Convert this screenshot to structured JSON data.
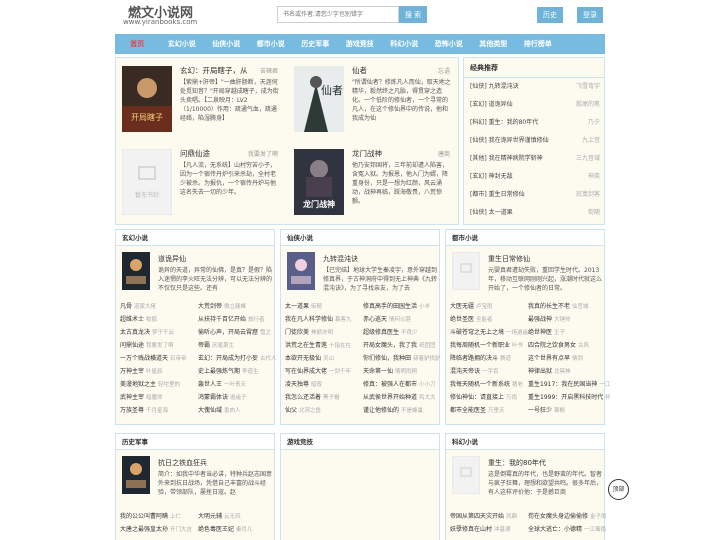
{
  "header": {
    "site_title": "燃文小说网",
    "site_url": "www.yiranbooks.com",
    "search_placeholder": "书名或作者,请您少字也别错字",
    "search_button": "搜 索",
    "history_button": "历史",
    "login_button": "登录"
  },
  "nav": [
    "首页",
    "玄幻小说",
    "仙侠小说",
    "都市小说",
    "历史军事",
    "游戏竞技",
    "科幻小说",
    "恐怖小说",
    "其他类型",
    "排行榜单"
  ],
  "featured": [
    {
      "title": "玄幻：开局瞎子，从",
      "author": "苦辣君",
      "desc": "【紫鼎+肝帝】\"一曲肝肠断，天涯何处觅知音？\"开局穿越成瞎子，成为街头卖唱。【二泉映月：LV2（1/10000）作用：疏通气血，疏通经络，陷湿腾身】"
    },
    {
      "title": "仙者",
      "author": "忘语",
      "desc": "\"所谓仙者？修炼凡人而仙，取天地之精华，毅然终之凡胎，得贯穿之造化。一个低阶的修仙者，一个寻常的凡人，在这个修仙界中的传说，他和我成为仙"
    },
    {
      "title": "问鼎仙途",
      "author": "我要发了啊",
      "desc": "【凡人流，无系统】山村穷苦小子，因为一个宿传丹炉引来杀劫，全村老少被杀。为报仇，一个宿传丹炉与他这名失去一切的少年。"
    },
    {
      "title": "龙门战神",
      "author": "唐商",
      "desc": "他乃安邦国将，三年前却遭人陷害，含冤入狱。为报恩，他入门为婿，降重身份，只是一想为红颜，风云涌动，战神再临，踩海敬畏，八荒惊颤。"
    }
  ],
  "featured_cover_text": [
    "开局瞎子",
    "仙者",
    "暂无书封",
    "龙门战神"
  ],
  "recs": {
    "title": "经典推荐",
    "items": [
      {
        "name": "[仙侠] 九转混沌诀",
        "author": "飞雪弯宇"
      },
      {
        "name": "[玄幻] 道诡异仙",
        "author": "狐尾的笔"
      },
      {
        "name": "[科幻] 重生：我的80年代",
        "author": "乃夕"
      },
      {
        "name": "[仙侠] 我在诡异世界谨慎修仙",
        "author": "九上宫"
      },
      {
        "name": "[其他] 我在精神病院学斩神",
        "author": "三九音域"
      },
      {
        "name": "[玄幻] 神封无敌",
        "author": "神奕"
      },
      {
        "name": "[都市] 重生日常修仙",
        "author": "寂寞剑客"
      },
      {
        "name": "[仙侠] 太一道果",
        "author": "街随"
      }
    ]
  },
  "categories": [
    {
      "name": "玄幻小说",
      "book_title": "道诡异仙",
      "book_desc": "诡异的天道，异常的仙佛，是真？是假？陷入迷惘的李火旺无法分辨，可以无法分辨的不仅仅只是这些。还有",
      "rows": [
        [
          "凡骨",
          "道家大佬",
          "大荒剑帝",
          "傲立巅峰"
        ],
        [
          "超维术士",
          "牧狐",
          "从扶持千百亿开始",
          "旅行者"
        ],
        [
          "太古真龙决",
          "梦子千云",
          "偷听心声，开局云霄窟",
          "雪之"
        ],
        [
          "问鼎仙途",
          "我要发了啊",
          "帝霸",
          "厌笔萧生"
        ],
        [
          "一万个贱战横道天",
          "石帝帝",
          "玄幻：开局成为打小妄",
          "古代人"
        ],
        [
          "万神主宰",
          "叶星辰",
          "史上最强炼气期",
          "李道生"
        ],
        [
          "美漫地狱之主",
          "轻坨里的",
          "轰世人王",
          "一叶青天"
        ],
        [
          "武神主宰",
          "暗魔师",
          "鸿蒙霸体诀",
          "逍遥子"
        ],
        [
          "万族圣尊",
          "千月星海",
          "大傀仙域",
          "香肉人"
        ]
      ]
    },
    {
      "name": "仙侠小说",
      "book_title": "九转混沌诀",
      "book_desc": "【已完结】地球大学生秦凌宇，意外穿越到修真界，于古神洞府中得到无上神典《九转混沌诀》，为了寻找亲友，为了去",
      "rows": [
        [
          "太一道果",
          "街随",
          "修真高手的田园生活",
          "小羊"
        ],
        [
          "我在凡人科学修仙",
          "慕客九",
          "赤心巡天",
          "情何以甚"
        ],
        [
          "门徒欣美",
          "神颜亦明",
          "超级修真医生",
          "不良少"
        ],
        [
          "洪荒之在生青莲",
          "十指在在",
          "开局女魔头，我了我",
          "纸团团"
        ],
        [
          "本欲开无极仙",
          "灵山",
          "你们修仙，我种田",
          "骑着驴找驴"
        ],
        [
          "写在仙界成大佬",
          "一剑千年",
          "天命第一仙",
          "情明雨桐"
        ],
        [
          "凌天独尊",
          "暗寂",
          "修真：被强人在都市",
          "小小刀"
        ],
        [
          "我怎么还活着",
          "黑子帽",
          "从武侯世界开始种道",
          "鸡大大"
        ],
        [
          "仙父",
          "北溟之鱼",
          "谨让他修仙的",
          "不是蜂巢"
        ]
      ]
    },
    {
      "name": "都市小说",
      "book_title": "重生日常修仙",
      "book_desc": "元婴真君遭劫失败，重回学生时代。2013年，移动互联网刚刚兴起，涨潮时代就这么开始了，一个修仙者的日常。",
      "rows": [
        [
          "大医无疆",
          "卢宝雨",
          "我真的长生不老",
          "仙宫城"
        ],
        [
          "绝世圣医",
          "全能者",
          "最强战神",
          "大锤帅"
        ],
        [
          "斗破苍穹之无上之境",
          "一场逍遥",
          "绝世神医",
          "王子"
        ],
        [
          "我每周随机一个新职业",
          "叶书",
          "四合院之饮食男女",
          "古风"
        ],
        [
          "降临者路拥的决斗",
          "赛道",
          "这个世界有点早",
          "情剑"
        ],
        [
          "混沌天帝诀",
          "一字百",
          "神律出狱",
          "北冥神"
        ],
        [
          "我每天随机一个新系统",
          "猪老",
          "重生1917：我在民国当神",
          "一江秋"
        ],
        [
          "修仙神仙：请直接上",
          "万雨",
          "重生1999：开启黑科技时代",
          "杯可"
        ],
        [
          "都市全能医圣",
          "万里天",
          "一号狂少",
          "萧枫"
        ]
      ]
    }
  ],
  "categories2": [
    {
      "name": "历史军事",
      "book_title": "抗日之铁血狂兵",
      "book_desc": "简介：如我中华者当必讲，特种兵赵志国意外来到抗日战场，凭借自己丰富的战斗经验，带领部队，屡挫日寇。赵",
      "rows": [
        [
          "我的公公叫曹阿瞒",
          "上仁"
        ],
        [
          "大唐之最强皇太孙",
          "开门大吉"
        ]
      ],
      "rows2": [
        [
          "大明元辅",
          "云无风"
        ],
        [
          "绝色毒医王妃",
          "秦月儿"
        ]
      ]
    },
    {
      "name": "游戏竞技",
      "book_title": "",
      "book_desc": "",
      "rows": [],
      "rows2": []
    },
    {
      "name": "科幻小说",
      "book_title": "重生：我的80年代",
      "book_desc": "这是倒霉真的年代，也是野蛮的年代。智者与疯子狂舞，理想和欲望共鸣。很多年后，有人这样评价他：于是撼巨商",
      "rows": [
        [
          "帝国从第四天灾开始",
          "风鼎"
        ],
        [
          "妖孽修真在山村",
          "冲基律"
        ]
      ],
      "rows2": [
        [
          "苟在女魔头身边偷偷修",
          "金子雨"
        ],
        [
          "全球大逃亡：小德精",
          "一江烟雨"
        ]
      ]
    }
  ],
  "cover_noimg": "暂无书封",
  "top_button": "顶部",
  "colors": {
    "nav_bg": "#77bce0",
    "accent_red": "#e8434a",
    "button_blue": "#6fb3d9",
    "panel_border": "#cfe3ee",
    "panel_bg": "#fdfaf0"
  }
}
